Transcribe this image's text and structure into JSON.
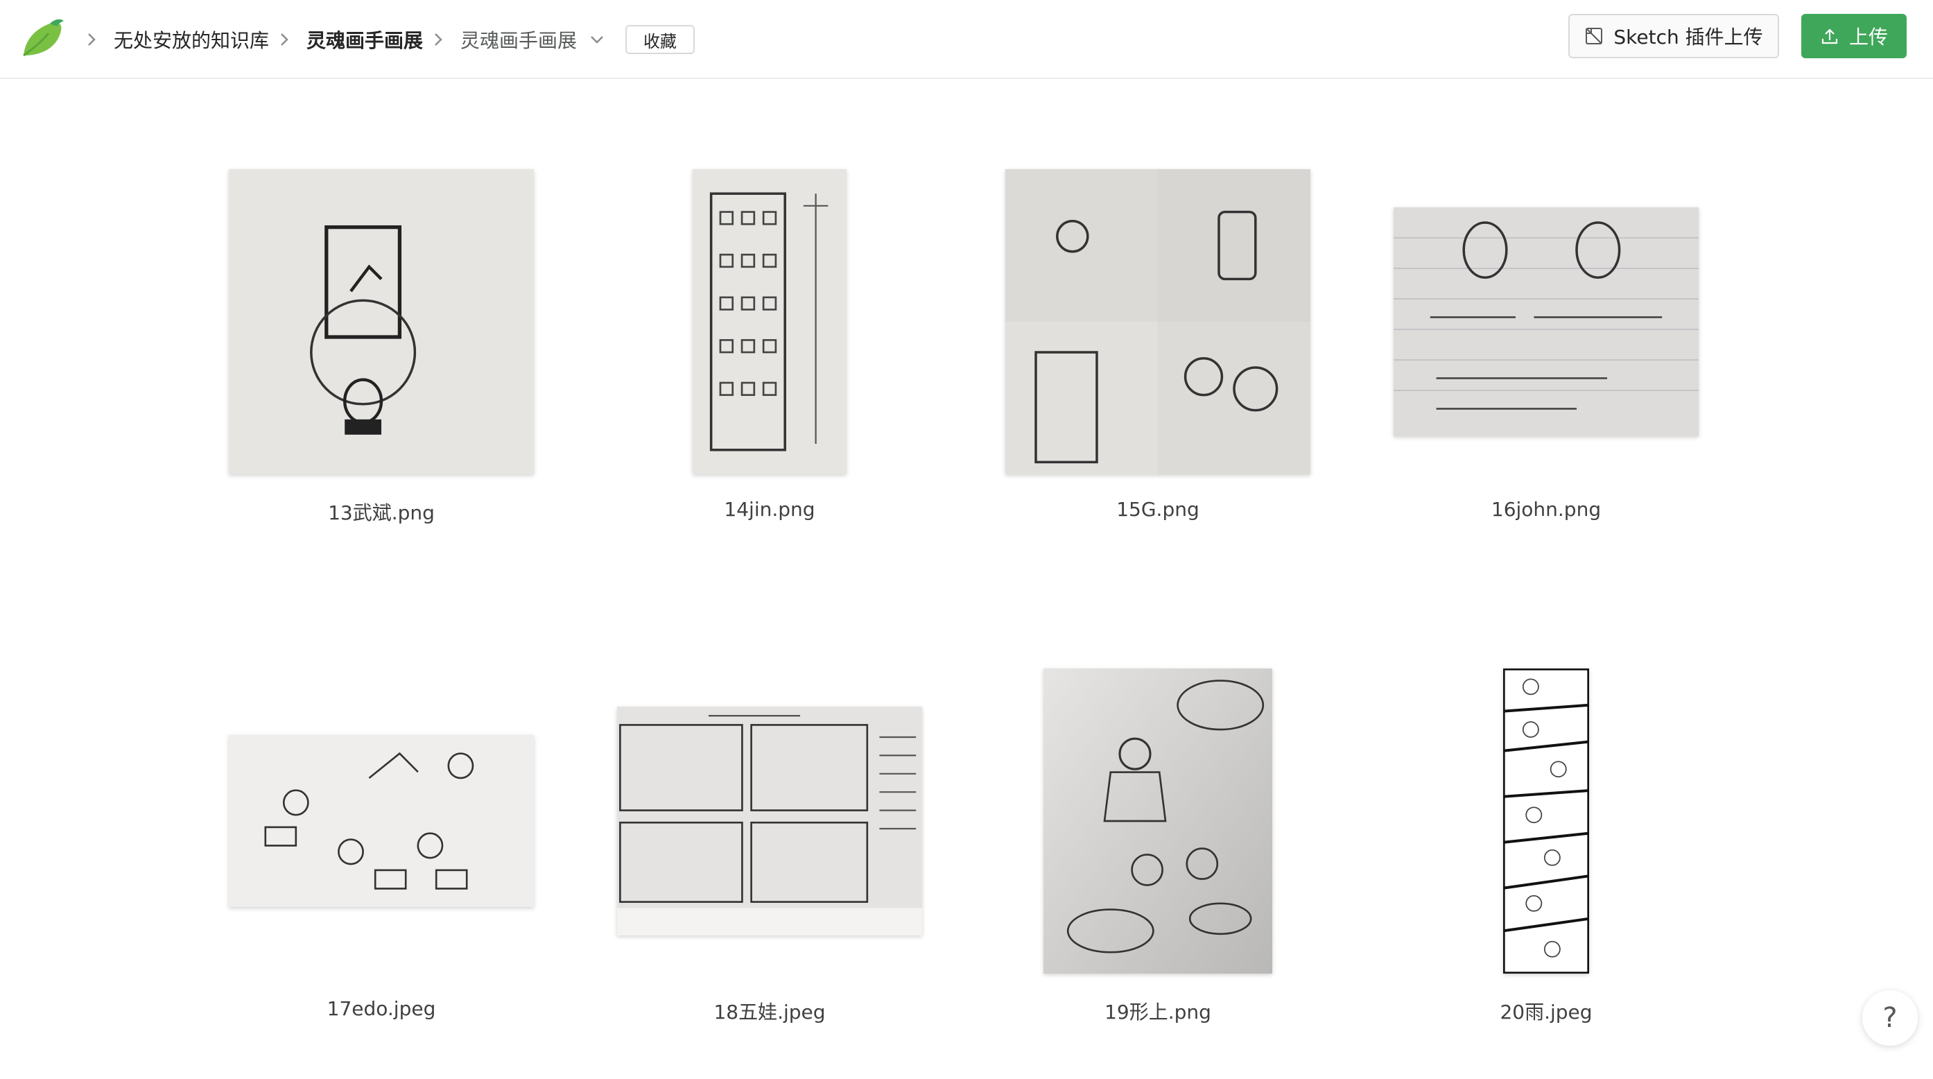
{
  "breadcrumb": {
    "items": [
      {
        "label": "无处安放的知识库"
      },
      {
        "label": "灵魂画手画展"
      },
      {
        "label": "灵魂画手画展"
      }
    ],
    "favorite_label": "收藏"
  },
  "toolbar": {
    "sketch_upload_label": "Sketch 插件上传",
    "upload_label": "上传"
  },
  "gallery": {
    "items": [
      {
        "name": "13武斌.png"
      },
      {
        "name": "14jin.png"
      },
      {
        "name": "15G.png"
      },
      {
        "name": "16john.png"
      },
      {
        "name": "17edo.jpeg"
      },
      {
        "name": "18五娃.jpeg"
      },
      {
        "name": "19形上.png"
      },
      {
        "name": "20雨.jpeg"
      }
    ]
  },
  "help": {
    "label": "?"
  },
  "colors": {
    "brand_green": "#3fa75a",
    "logo_green": "#7ac143"
  }
}
